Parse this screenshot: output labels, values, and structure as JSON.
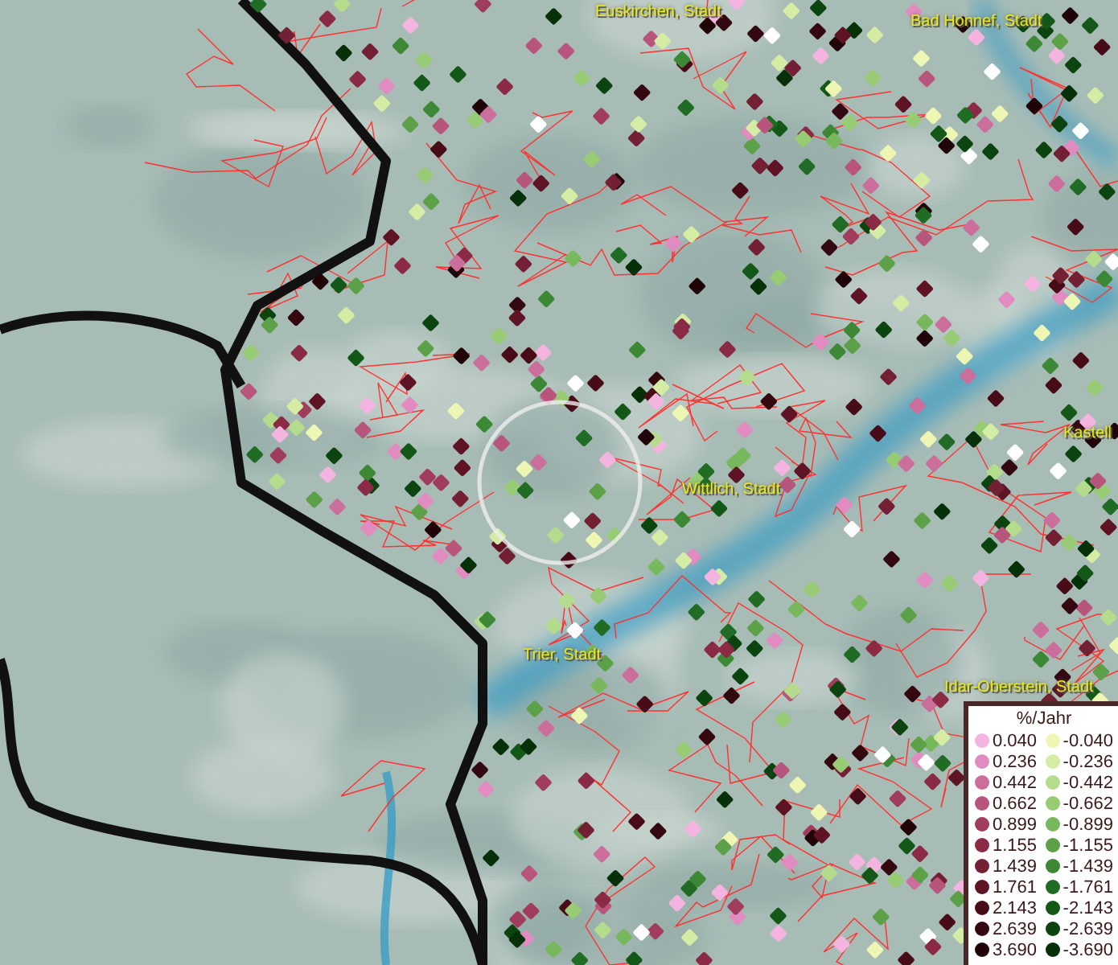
{
  "map": {
    "places": [
      {
        "label": "Euskirchen, Stadt"
      },
      {
        "label": "Bad Honnef, Stadt"
      },
      {
        "label": "Kastell"
      },
      {
        "label": "Wittlich, Stadt"
      },
      {
        "label": "Trier, Stadt"
      },
      {
        "label": "Idar-Oberstein, Stadt"
      }
    ]
  },
  "legend": {
    "title": "%/Jahr",
    "items": [
      {
        "label": "0.040",
        "color": "#f4b4e0"
      },
      {
        "label": "-0.040",
        "color": "#eef6b4"
      },
      {
        "label": "0.236",
        "color": "#e08cc0"
      },
      {
        "label": "-0.236",
        "color": "#d4eca4"
      },
      {
        "label": "0.442",
        "color": "#cc6e9c"
      },
      {
        "label": "-0.442",
        "color": "#b4dc8c"
      },
      {
        "label": "0.662",
        "color": "#b8557c"
      },
      {
        "label": "-0.662",
        "color": "#98cc74"
      },
      {
        "label": "0.899",
        "color": "#a03c5c"
      },
      {
        "label": "-0.899",
        "color": "#78b85c"
      },
      {
        "label": "1.155",
        "color": "#8a2a44"
      },
      {
        "label": "-1.155",
        "color": "#5ca048"
      },
      {
        "label": "1.439",
        "color": "#742034"
      },
      {
        "label": "-1.439",
        "color": "#3c8834"
      },
      {
        "label": "1.761",
        "color": "#5e1424"
      },
      {
        "label": "-1.761",
        "color": "#206c24"
      },
      {
        "label": "2.143",
        "color": "#480c18"
      },
      {
        "label": "-2.143",
        "color": "#145818"
      },
      {
        "label": "2.639",
        "color": "#340810"
      },
      {
        "label": "-2.639",
        "color": "#0c4410"
      },
      {
        "label": "3.690",
        "color": "#200408"
      },
      {
        "label": "-3.690",
        "color": "#063008"
      }
    ]
  }
}
